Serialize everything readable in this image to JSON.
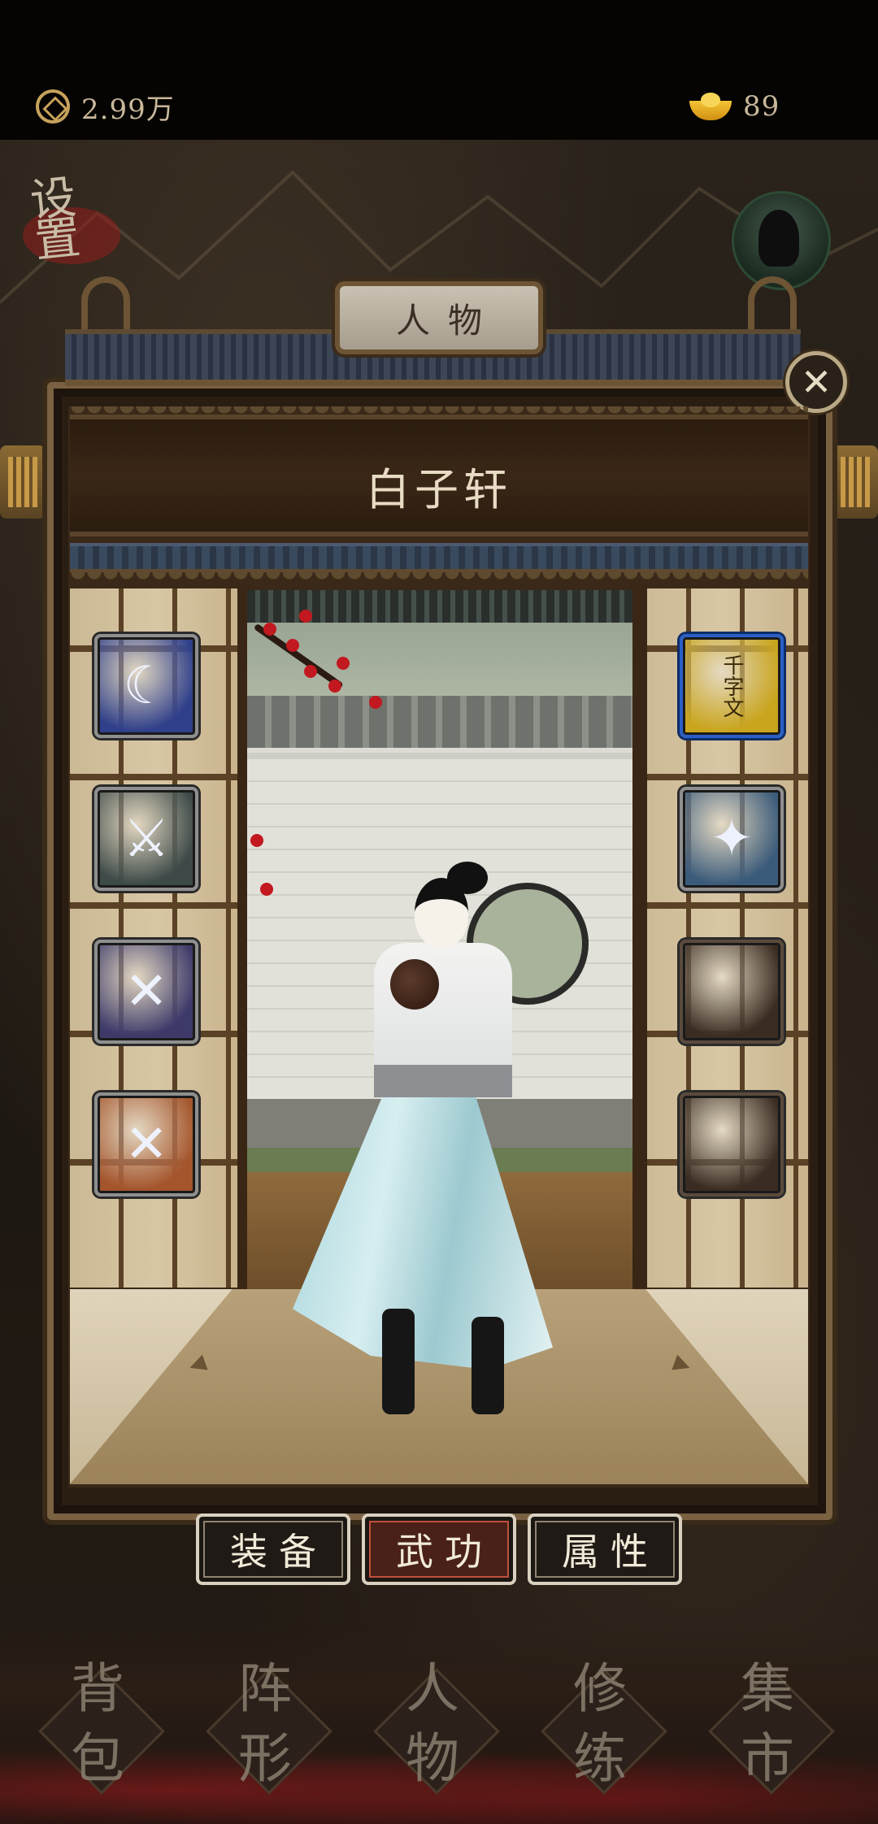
{
  "currency": {
    "coins": "2.99万",
    "gold": "89"
  },
  "settings_label": "设置",
  "title": "人物",
  "character_name": "白子轩",
  "skills_left": [
    {
      "icon": "blue-shadow-skill-icon",
      "glyph": "☾",
      "bg": "#2f3f8a"
    },
    {
      "icon": "sword-slash-skill-icon",
      "glyph": "⚔",
      "bg": "#3d4a48"
    },
    {
      "icon": "crossed-swords-skill-icon",
      "glyph": "✕",
      "bg": "#3d3a6a"
    },
    {
      "icon": "crossed-blades-fire-skill-icon",
      "glyph": "✕",
      "bg": "#a4552c"
    }
  ],
  "skills_right": [
    {
      "icon": "yellow-book-icon",
      "glyph": "千字文",
      "bg": "#c9a51d",
      "selected": true
    },
    {
      "icon": "flying-kick-skill-icon",
      "glyph": "✦",
      "bg": "#3b5b7a",
      "selected": false
    },
    {
      "icon": "empty-book-slot-icon",
      "glyph": "",
      "bg": "#3a2c22",
      "selected": false,
      "empty": true
    },
    {
      "icon": "empty-book-slot-icon",
      "glyph": "",
      "bg": "#3a2c22",
      "selected": false,
      "empty": true
    }
  ],
  "tabs": [
    {
      "label": "装备",
      "active": false
    },
    {
      "label": "武功",
      "active": true
    },
    {
      "label": "属性",
      "active": false
    }
  ],
  "bottom_nav": [
    {
      "label": "背包",
      "line1": "背",
      "line2": "包"
    },
    {
      "label": "阵形",
      "line1": "阵",
      "line2": "形"
    },
    {
      "label": "人物",
      "line1": "人",
      "line2": "物"
    },
    {
      "label": "修练",
      "line1": "修",
      "line2": "练"
    },
    {
      "label": "集市",
      "line1": "集",
      "line2": "市"
    }
  ],
  "colors": {
    "accent_red": "#c2181f",
    "frame_wood": "#7a6142",
    "selected_blue": "#2a5fc6"
  }
}
